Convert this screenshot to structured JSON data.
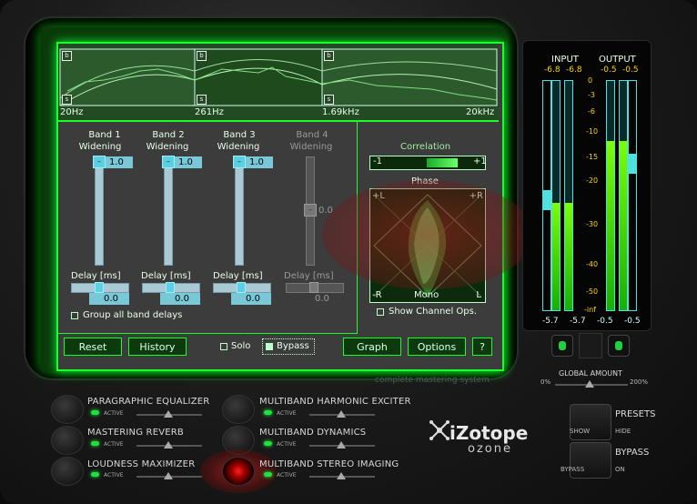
{
  "spectrum": {
    "freq_labels": [
      "20Hz",
      "261Hz",
      "1.69kHz",
      "20kHz"
    ],
    "band_marker_b": "b",
    "band_marker_s": "s"
  },
  "bands": [
    {
      "title": "Band 1",
      "subtitle": "Widening",
      "value": "1.0",
      "delay_label": "Delay [ms]",
      "delay_value": "0.0",
      "enabled": true
    },
    {
      "title": "Band 2",
      "subtitle": "Widening",
      "value": "1.0",
      "delay_label": "Delay [ms]",
      "delay_value": "0.0",
      "enabled": true
    },
    {
      "title": "Band 3",
      "subtitle": "Widening",
      "value": "1.0",
      "delay_label": "Delay [ms]",
      "delay_value": "0.0",
      "enabled": true
    },
    {
      "title": "Band 4",
      "subtitle": "Widening",
      "value": "0.0",
      "delay_label": "Delay [ms]",
      "delay_value": "0.0",
      "enabled": false
    }
  ],
  "group_delays_label": "Group all band delays",
  "correlation": {
    "label": "Correlation",
    "min": "-1",
    "max": "+1"
  },
  "phase": {
    "label": "Phase",
    "tl": "+L",
    "tr": "+R",
    "bl": "-R",
    "br": "L",
    "bottom": "Mono"
  },
  "show_channel_ops_label": "Show Channel Ops.",
  "toolbar": {
    "reset": "Reset",
    "history": "History",
    "solo": "Solo",
    "bypass": "Bypass",
    "graph": "Graph",
    "options": "Options",
    "help": "?"
  },
  "tagline": "complete mastering system",
  "meters": {
    "input_label": "INPUT",
    "output_label": "OUTPUT",
    "input_peak_l": "-6.8",
    "input_peak_r": "-6.8",
    "output_peak_l": "-0.5",
    "output_peak_r": "-0.5",
    "input_rms_l": "-5.7",
    "input_rms_r": "-5.7",
    "output_rms_l": "-0.5",
    "output_rms_r": "-0.5",
    "scale": [
      "0",
      "-3",
      "-6",
      "-10",
      "-15",
      "-20",
      "-30",
      "-40",
      "-50",
      "-inf"
    ],
    "input_level_l": 0.47,
    "input_level_r": 0.47,
    "output_level_l": 0.74,
    "output_level_r": 0.74
  },
  "global_amount": {
    "label": "GLOBAL AMOUNT",
    "min": "0%",
    "max": "200%"
  },
  "modules": [
    {
      "name": "PARAGRAPHIC EQUALIZER",
      "status": "ACTIVE"
    },
    {
      "name": "MASTERING REVERB",
      "status": "ACTIVE"
    },
    {
      "name": "LOUDNESS MAXIMIZER",
      "status": "ACTIVE"
    },
    {
      "name": "MULTIBAND HARMONIC EXCITER",
      "status": "ACTIVE"
    },
    {
      "name": "MULTIBAND DYNAMICS",
      "status": "ACTIVE"
    },
    {
      "name": "MULTIBAND STEREO IMAGING",
      "status": "ACTIVE"
    }
  ],
  "brand": {
    "name": "iZotope",
    "product": "ozone"
  },
  "presets": {
    "label": "PRESETS",
    "show": "SHOW",
    "hide": "HIDE"
  },
  "bypass_panel": {
    "label": "BYPASS",
    "bypass": "BYPASS",
    "on": "ON"
  },
  "colors": {
    "accent": "#1aff2a",
    "slider": "#5cd0e0",
    "meter_label": "#ffd400"
  }
}
